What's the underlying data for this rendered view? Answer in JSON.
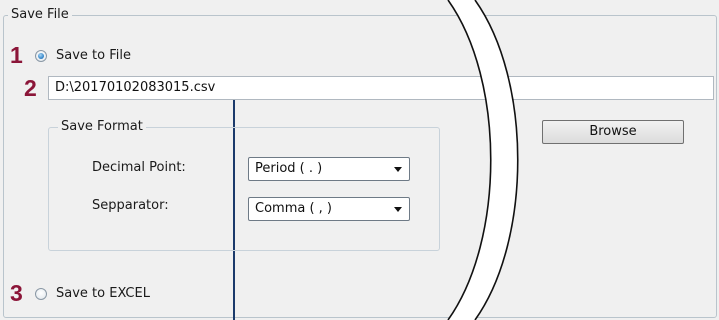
{
  "group": {
    "title": "Save File"
  },
  "callouts": {
    "one": "1",
    "two": "2",
    "three": "3"
  },
  "save_to_file": {
    "label": "Save to File",
    "selected": true
  },
  "file_path": {
    "value": "D:\\20170102083015.csv"
  },
  "save_format": {
    "title": "Save Format",
    "decimal_point": {
      "label": "Decimal Point:",
      "value": "Period ( . )"
    },
    "separator": {
      "label": "Sepparator:",
      "value": "Comma ( , )"
    }
  },
  "browse": {
    "label": "Browse"
  },
  "save_to_excel": {
    "label": "Save to EXCEL",
    "selected": false
  },
  "colors": {
    "callout": "#8b1538",
    "pointer_line": "#1b3a6b",
    "radio_selected": "#2a7ec4"
  }
}
